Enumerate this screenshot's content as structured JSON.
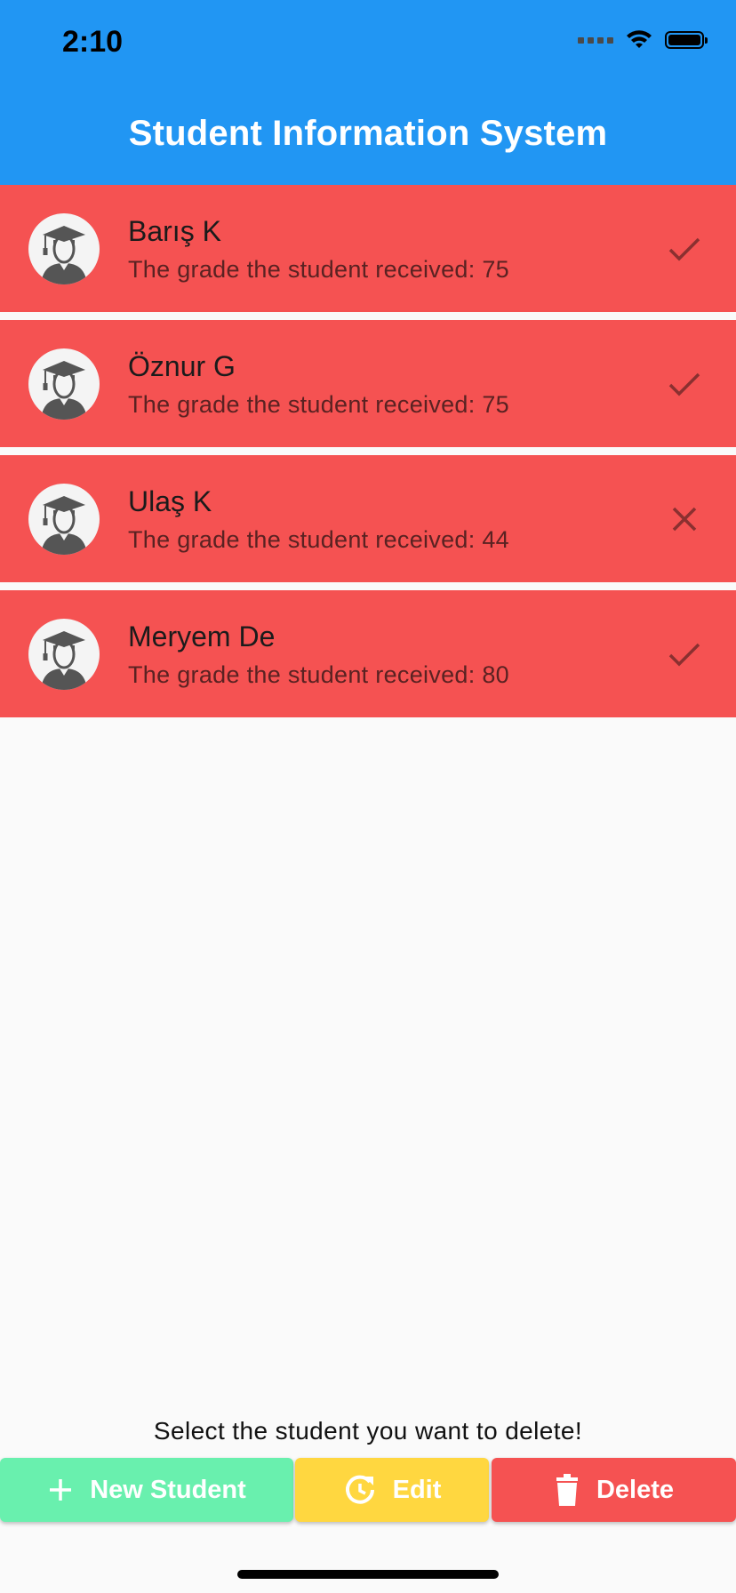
{
  "status_bar": {
    "time": "2:10"
  },
  "app_bar": {
    "title": "Student Information System"
  },
  "students": [
    {
      "name": "Barış K",
      "grade_text": "The grade the student received: 75",
      "status": "passed"
    },
    {
      "name": "Öznur G",
      "grade_text": "The grade the student received: 75",
      "status": "passed"
    },
    {
      "name": "Ulaş K",
      "grade_text": "The grade the student received: 44",
      "status": "failed"
    },
    {
      "name": "Meryem De",
      "grade_text": "The grade the student received: 80",
      "status": "passed"
    }
  ],
  "hint": "Select the student you want to delete!",
  "buttons": {
    "new_student": "New Student",
    "edit": "Edit",
    "delete": "Delete"
  },
  "colors": {
    "app_bar": "#2196F3",
    "row": "#F55252",
    "new_button": "#69F0AE",
    "edit_button": "#FFD740",
    "delete_button": "#F55252"
  },
  "icons": {
    "avatar": "graduate-avatar-icon",
    "passed": "check-icon",
    "failed": "close-icon",
    "new": "plus-icon",
    "edit": "refresh-icon",
    "delete": "trash-icon"
  }
}
